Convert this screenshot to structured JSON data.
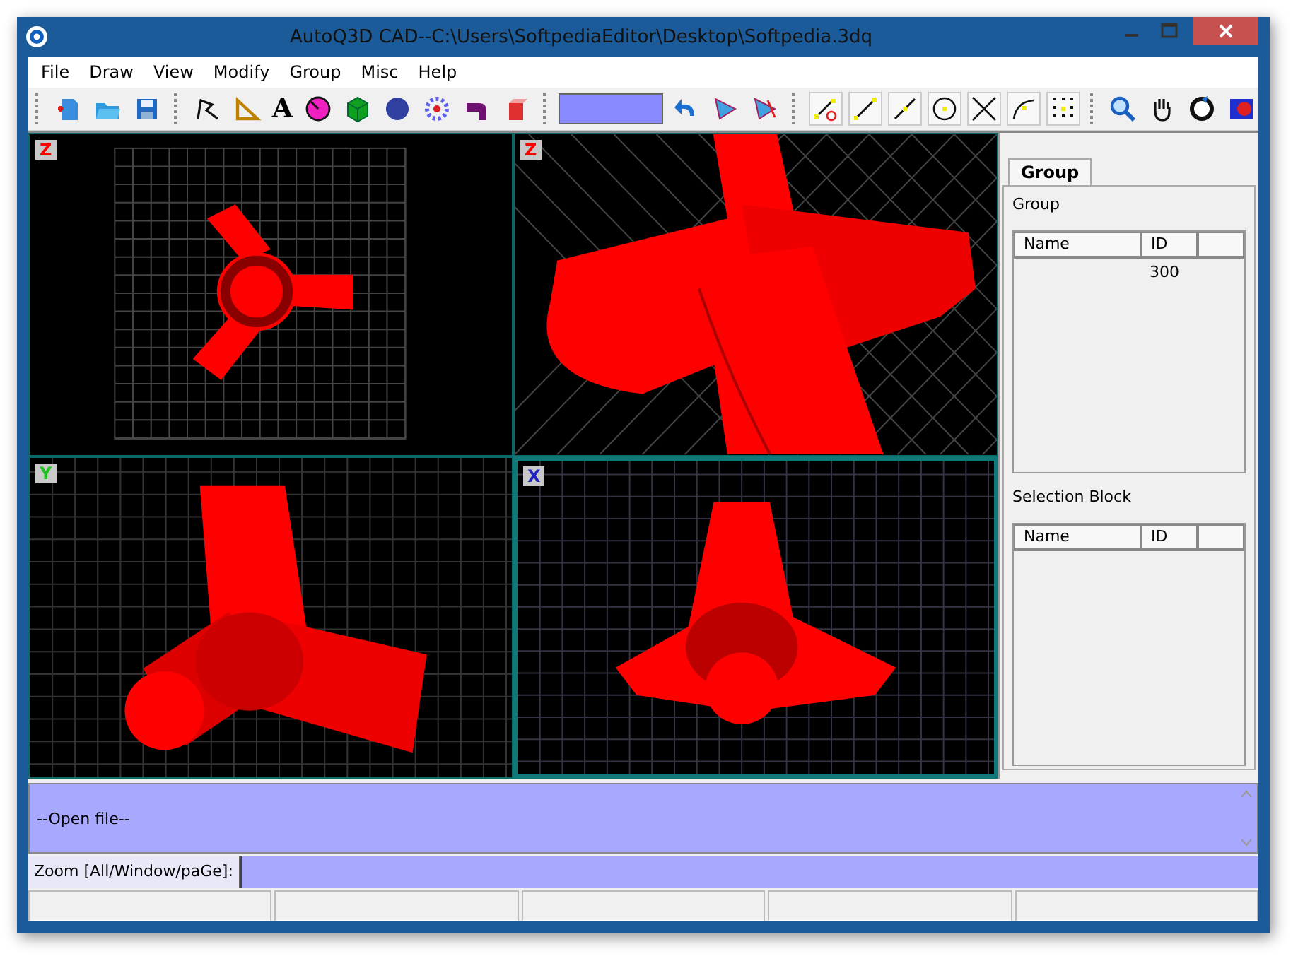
{
  "window": {
    "title": "AutoQ3D CAD--C:\\Users\\SoftpediaEditor\\Desktop\\Softpedia.3dq"
  },
  "menu": [
    "File",
    "Draw",
    "View",
    "Modify",
    "Group",
    "Misc",
    "Help"
  ],
  "toolbar": {
    "text_tool_label": "A"
  },
  "viewports": [
    {
      "axis_label": "Z",
      "color": "#ff0000",
      "selected": false,
      "kind": "top"
    },
    {
      "axis_label": "Z",
      "color": "#ff0000",
      "selected": false,
      "kind": "perspective"
    },
    {
      "axis_label": "Y",
      "color": "#20c020",
      "selected": false,
      "kind": "front"
    },
    {
      "axis_label": "X",
      "color": "#2020c0",
      "selected": true,
      "kind": "side"
    }
  ],
  "side_panel": {
    "tabs": [
      {
        "label": "Group",
        "selected": true
      }
    ],
    "sections": [
      {
        "label": "Group",
        "columns": [
          "Name",
          "ID"
        ],
        "rows": [
          {
            "id": "300"
          }
        ]
      },
      {
        "label": "Selection Block",
        "columns": [
          "Name",
          "ID"
        ]
      }
    ]
  },
  "command_output": "--Open file--",
  "prompt": {
    "label": "Zoom [All/Window/paGe]:"
  }
}
